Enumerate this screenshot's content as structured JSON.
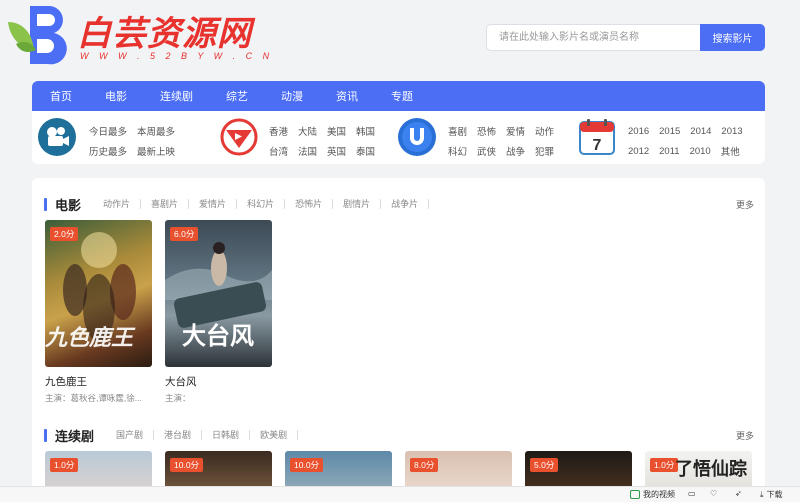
{
  "site": {
    "title": "白芸资源网",
    "url": "W W W . 5 2 B Y W . C N"
  },
  "search": {
    "placeholder": "请在此处输入影片名或演员名称",
    "button_label": "搜索影片"
  },
  "nav": [
    "首页",
    "电影",
    "连续剧",
    "综艺",
    "动漫",
    "资讯",
    "专题"
  ],
  "categories": {
    "group1": {
      "icon": "film-camera-icon",
      "rows": [
        [
          "今日最多",
          "本周最多"
        ],
        [
          "历史最多",
          "最新上映"
        ]
      ]
    },
    "group2": {
      "icon": "play-icon",
      "rows": [
        [
          "香港",
          "大陆",
          "美国",
          "韩国"
        ],
        [
          "台湾",
          "法国",
          "英国",
          "泰国"
        ]
      ]
    },
    "group3": {
      "icon": "u-icon",
      "rows": [
        [
          "喜剧",
          "恐怖",
          "爱情",
          "动作"
        ],
        [
          "科幻",
          "武侠",
          "战争",
          "犯罪"
        ]
      ]
    },
    "group4": {
      "icon": "calendar-icon",
      "calendar_day": "7",
      "rows": [
        [
          "2016",
          "2015",
          "2014",
          "2013"
        ],
        [
          "2012",
          "2011",
          "2010",
          "其他"
        ]
      ]
    }
  },
  "movies_section": {
    "title": "电影",
    "tags": [
      "动作片",
      "喜剧片",
      "爱情片",
      "科幻片",
      "恐怖片",
      "剧情片",
      "战争片"
    ],
    "more": "更多",
    "items": [
      {
        "title": "九色鹿王",
        "cast": "主演：葛秋谷,谭咏霆,徐...",
        "score": "2.0分",
        "poster_text": "九色鹿王"
      },
      {
        "title": "大台风",
        "cast": "主演：",
        "score": "6.0分",
        "poster_text": "大台风"
      }
    ]
  },
  "series_section": {
    "title": "连续剧",
    "tags": [
      "国产剧",
      "港台剧",
      "日韩剧",
      "欧美剧"
    ],
    "more": "更多",
    "scores": [
      "1.0分",
      "10.0分",
      "10.0分",
      "8.0分",
      "5.0分",
      "1.0分"
    ],
    "last_poster_text": "了悟仙踪"
  },
  "statusbar": {
    "my_video": "我的视频",
    "download": "下载"
  },
  "colors": {
    "accent": "#4b6ef5",
    "brand_red": "#e8322e",
    "score_badge": "#e8502e"
  }
}
